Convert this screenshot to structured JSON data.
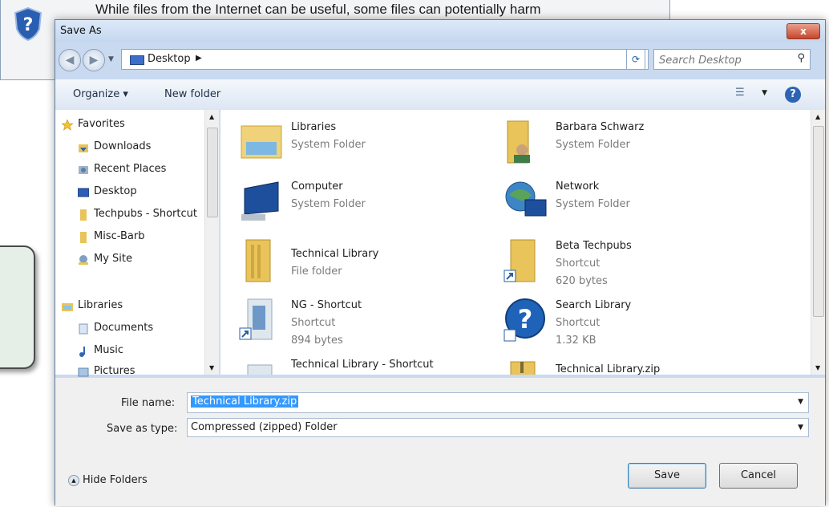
{
  "background_dialog": {
    "text": "While files from the Internet can be useful, some files can potentially harm"
  },
  "window": {
    "title": "Save As",
    "close_label": "x"
  },
  "address": {
    "location": "Desktop",
    "search_placeholder": "Search Desktop"
  },
  "toolbar": {
    "organize": "Organize ▾",
    "new_folder": "New folder"
  },
  "nav_pane": {
    "items": [
      {
        "label": "Favorites",
        "icon": "star-icon"
      },
      {
        "label": "Downloads",
        "icon": "downloads-icon"
      },
      {
        "label": "Recent Places",
        "icon": "recent-places-icon"
      },
      {
        "label": "Desktop",
        "icon": "desktop-icon"
      },
      {
        "label": "Techpubs - Shortcut",
        "icon": "folder-shortcut-icon"
      },
      {
        "label": "Misc-Barb",
        "icon": "folder-icon"
      },
      {
        "label": "My Site",
        "icon": "my-site-icon"
      },
      {
        "label": "Libraries",
        "icon": "libraries-icon"
      },
      {
        "label": "Documents",
        "icon": "documents-icon"
      },
      {
        "label": "Music",
        "icon": "music-icon"
      },
      {
        "label": "Pictures",
        "icon": "pictures-icon"
      }
    ]
  },
  "content": {
    "items": [
      {
        "name": "Libraries",
        "line2": "System Folder",
        "line3": "",
        "icon": "libraries-folder-icon"
      },
      {
        "name": "Barbara Schwarz",
        "line2": "System Folder",
        "line3": "",
        "icon": "user-folder-icon"
      },
      {
        "name": "Computer",
        "line2": "System Folder",
        "line3": "",
        "icon": "computer-icon"
      },
      {
        "name": "Network",
        "line2": "System Folder",
        "line3": "",
        "icon": "network-icon"
      },
      {
        "name": "Technical Library",
        "line2": "File folder",
        "line3": "",
        "icon": "folder-icon"
      },
      {
        "name": "Beta   Techpubs",
        "line2": "Shortcut",
        "line3": "620 bytes",
        "icon": "folder-shortcut-icon"
      },
      {
        "name": "NG - Shortcut",
        "line2": "Shortcut",
        "line3": "894 bytes",
        "icon": "folder-shortcut-icon"
      },
      {
        "name": "Search Library",
        "line2": "Shortcut",
        "line3": "1.32 KB",
        "icon": "help-shortcut-icon"
      },
      {
        "name": "Technical Library - Shortcut",
        "line2": "",
        "line3": "",
        "icon": "folder-shortcut-icon"
      },
      {
        "name": "Technical Library.zip",
        "line2": "",
        "line3": "",
        "icon": "zip-folder-icon"
      }
    ]
  },
  "form": {
    "file_name_label": "File name:",
    "file_name_value": "Technical Library.zip",
    "save_type_label": "Save as type:",
    "save_type_value": "Compressed (zipped) Folder"
  },
  "footer": {
    "hide_folders": "Hide Folders",
    "save": "Save",
    "cancel": "Cancel"
  },
  "colors": {
    "dialog_frame": "#c9daf0",
    "selection": "#3399ff",
    "close_button": "#c8452a"
  }
}
